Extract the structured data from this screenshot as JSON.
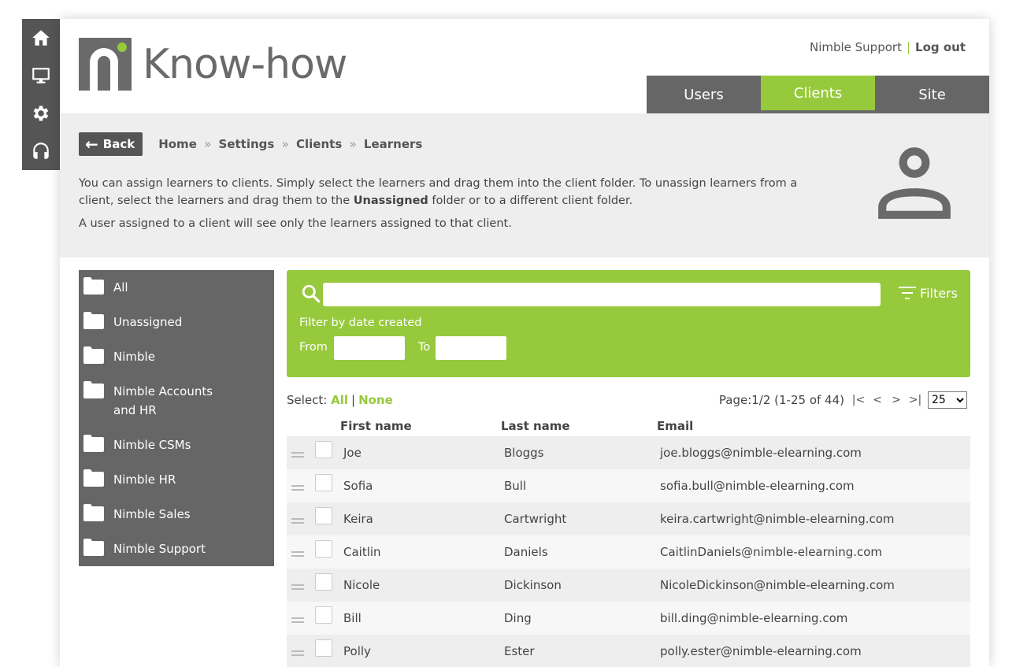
{
  "rail": [
    {
      "name": "home-icon",
      "label": "Home"
    },
    {
      "name": "monitor-icon",
      "label": "Courses"
    },
    {
      "name": "gear-icon",
      "label": "Settings"
    },
    {
      "name": "headset-icon",
      "label": "Support"
    }
  ],
  "header": {
    "logo_text": "Know-how",
    "user_name": "Nimble Support",
    "separator": "|",
    "logout_label": "Log out"
  },
  "tabs": [
    {
      "label": "Users",
      "active": false
    },
    {
      "label": "Clients",
      "active": true
    },
    {
      "label": "Site",
      "active": false
    }
  ],
  "intro": {
    "back_label": "Back",
    "breadcrumb": [
      "Home",
      "Settings",
      "Clients",
      "Learners"
    ],
    "breadcrumb_sep": "»",
    "paragraph1_pre": "You can assign learners to clients. Simply select the learners and drag them into the client folder. To unassign learners from a client, select the learners and drag them to the ",
    "paragraph1_bold": "Unassigned",
    "paragraph1_post": " folder or to a different client folder.",
    "paragraph2": "A user assigned to a client will see only the learners assigned to that client."
  },
  "folders": [
    "All",
    "Unassigned",
    "Nimble",
    "Nimble Accounts and HR",
    "Nimble CSMs",
    "Nimble HR",
    "Nimble Sales",
    "Nimble Support"
  ],
  "filters": {
    "search_value": "",
    "filters_label": "Filters",
    "date_label": "Filter by date created",
    "from_label": "From",
    "to_label": "To"
  },
  "select": {
    "label": "Select:",
    "all": "All",
    "sep": "|",
    "none": "None"
  },
  "pager": {
    "text": "Page:1/2 (1-25 of 44)",
    "first": "|<",
    "prev": "<",
    "next": ">",
    "last": ">|",
    "page_size": "25"
  },
  "table": {
    "headers": [
      "First name",
      "Last name",
      "Email"
    ],
    "rows": [
      {
        "first": "Joe",
        "last": "Bloggs",
        "email": "joe.bloggs@nimble-elearning.com"
      },
      {
        "first": "Sofia",
        "last": "Bull",
        "email": "sofia.bull@nimble-elearning.com"
      },
      {
        "first": "Keira",
        "last": "Cartwright",
        "email": "keira.cartwright@nimble-elearning.com"
      },
      {
        "first": "Caitlin",
        "last": "Daniels",
        "email": "CaitlinDaniels@nimble-elearning.com"
      },
      {
        "first": "Nicole",
        "last": "Dickinson",
        "email": "NicoleDickinson@nimble-elearning.com"
      },
      {
        "first": "Bill",
        "last": "Ding",
        "email": "bill.ding@nimble-elearning.com"
      },
      {
        "first": "Polly",
        "last": "Ester",
        "email": "polly.ester@nimble-elearning.com"
      }
    ]
  },
  "colors": {
    "accent": "#97c93c",
    "dark": "#666666",
    "band": "#eeeeee"
  }
}
